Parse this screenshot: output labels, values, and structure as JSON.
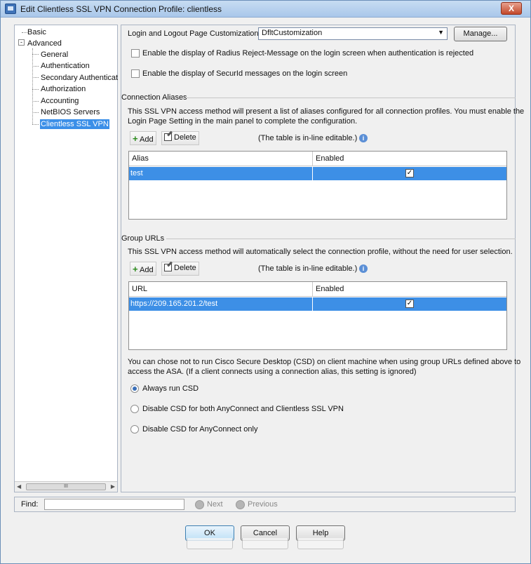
{
  "window": {
    "title": "Edit Clientless SSL VPN Connection Profile: clientless",
    "close_label": "X"
  },
  "nav": {
    "items": [
      {
        "label": "Basic"
      },
      {
        "label": "Advanced",
        "expander": "-"
      },
      {
        "label": "General"
      },
      {
        "label": "Authentication"
      },
      {
        "label": "Secondary Authenticat"
      },
      {
        "label": "Authorization"
      },
      {
        "label": "Accounting"
      },
      {
        "label": "NetBIOS Servers"
      },
      {
        "label": "Clientless SSL VPN"
      }
    ],
    "scroll_thumb": "III",
    "scroll_left": "◀",
    "scroll_right": "▶"
  },
  "customization": {
    "label": "Login and Logout Page Customization:",
    "value": "DfltCustomization",
    "manage_label": "Manage...",
    "radius_reject_label": "Enable the display of Radius Reject-Message on the login screen when authentication is rejected",
    "securid_label": "Enable the display of SecurId messages on the login screen"
  },
  "aliases": {
    "title": "Connection Aliases",
    "description_1": "This SSL VPN access method will present a list of aliases configured for all connection profiles. You must enable the",
    "description_2": "Login Page Setting in the main panel to complete the configuration.",
    "add_label": "Add",
    "delete_label": "Delete",
    "note": "(The table is in-line editable.)",
    "columns": [
      "Alias",
      "Enabled"
    ],
    "rows": [
      {
        "value": "test",
        "enabled": "✓"
      }
    ]
  },
  "group_urls": {
    "title": "Group URLs",
    "description": "This SSL VPN access method will automatically select the connection profile, without the need for user selection.",
    "add_label": "Add",
    "delete_label": "Delete",
    "note": "(The table is in-line editable.)",
    "columns": [
      "URL",
      "Enabled"
    ],
    "rows": [
      {
        "value": "https://209.165.201.2/test",
        "enabled": "✓"
      }
    ]
  },
  "csd": {
    "description_1": "You can chose not to run Cisco Secure Desktop (CSD) on client machine when using group URLs defined above to",
    "description_2": "access the ASA. (If a client connects using a connection alias, this setting is ignored)",
    "options": [
      {
        "label": "Always run CSD",
        "selected": true
      },
      {
        "label": "Disable CSD for both AnyConnect and Clientless SSL VPN",
        "selected": false
      },
      {
        "label": "Disable CSD for AnyConnect only",
        "selected": false
      }
    ]
  },
  "find": {
    "label": "Find:",
    "next_label": "Next",
    "previous_label": "Previous"
  },
  "buttons": {
    "ok": "OK",
    "cancel": "Cancel",
    "help": "Help"
  },
  "icons": {
    "info": "i",
    "plus": "+"
  },
  "colors": {
    "selection": "#3d8fe6",
    "titlebar": "#b8d2ef"
  }
}
